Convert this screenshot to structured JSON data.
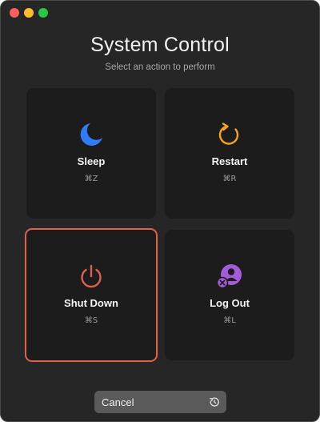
{
  "window": {
    "title": "System Control",
    "subtitle": "Select an action to perform"
  },
  "actions": [
    {
      "id": "sleep",
      "label": "Sleep",
      "shortcut": "⌘Z",
      "icon": "moon-icon",
      "color": "#2f7cf6"
    },
    {
      "id": "restart",
      "label": "Restart",
      "shortcut": "⌘R",
      "icon": "restart-arrow-icon",
      "color": "#f7a21b"
    },
    {
      "id": "shutdown",
      "label": "Shut Down",
      "shortcut": "⌘S",
      "icon": "power-icon",
      "color": "#e0604e",
      "selected": true
    },
    {
      "id": "logout",
      "label": "Log Out",
      "shortcut": "⌘L",
      "icon": "user-remove-icon",
      "color": "#a45bd9"
    }
  ],
  "cancel": {
    "label": "Cancel",
    "icon": "countdown-timer-icon"
  }
}
